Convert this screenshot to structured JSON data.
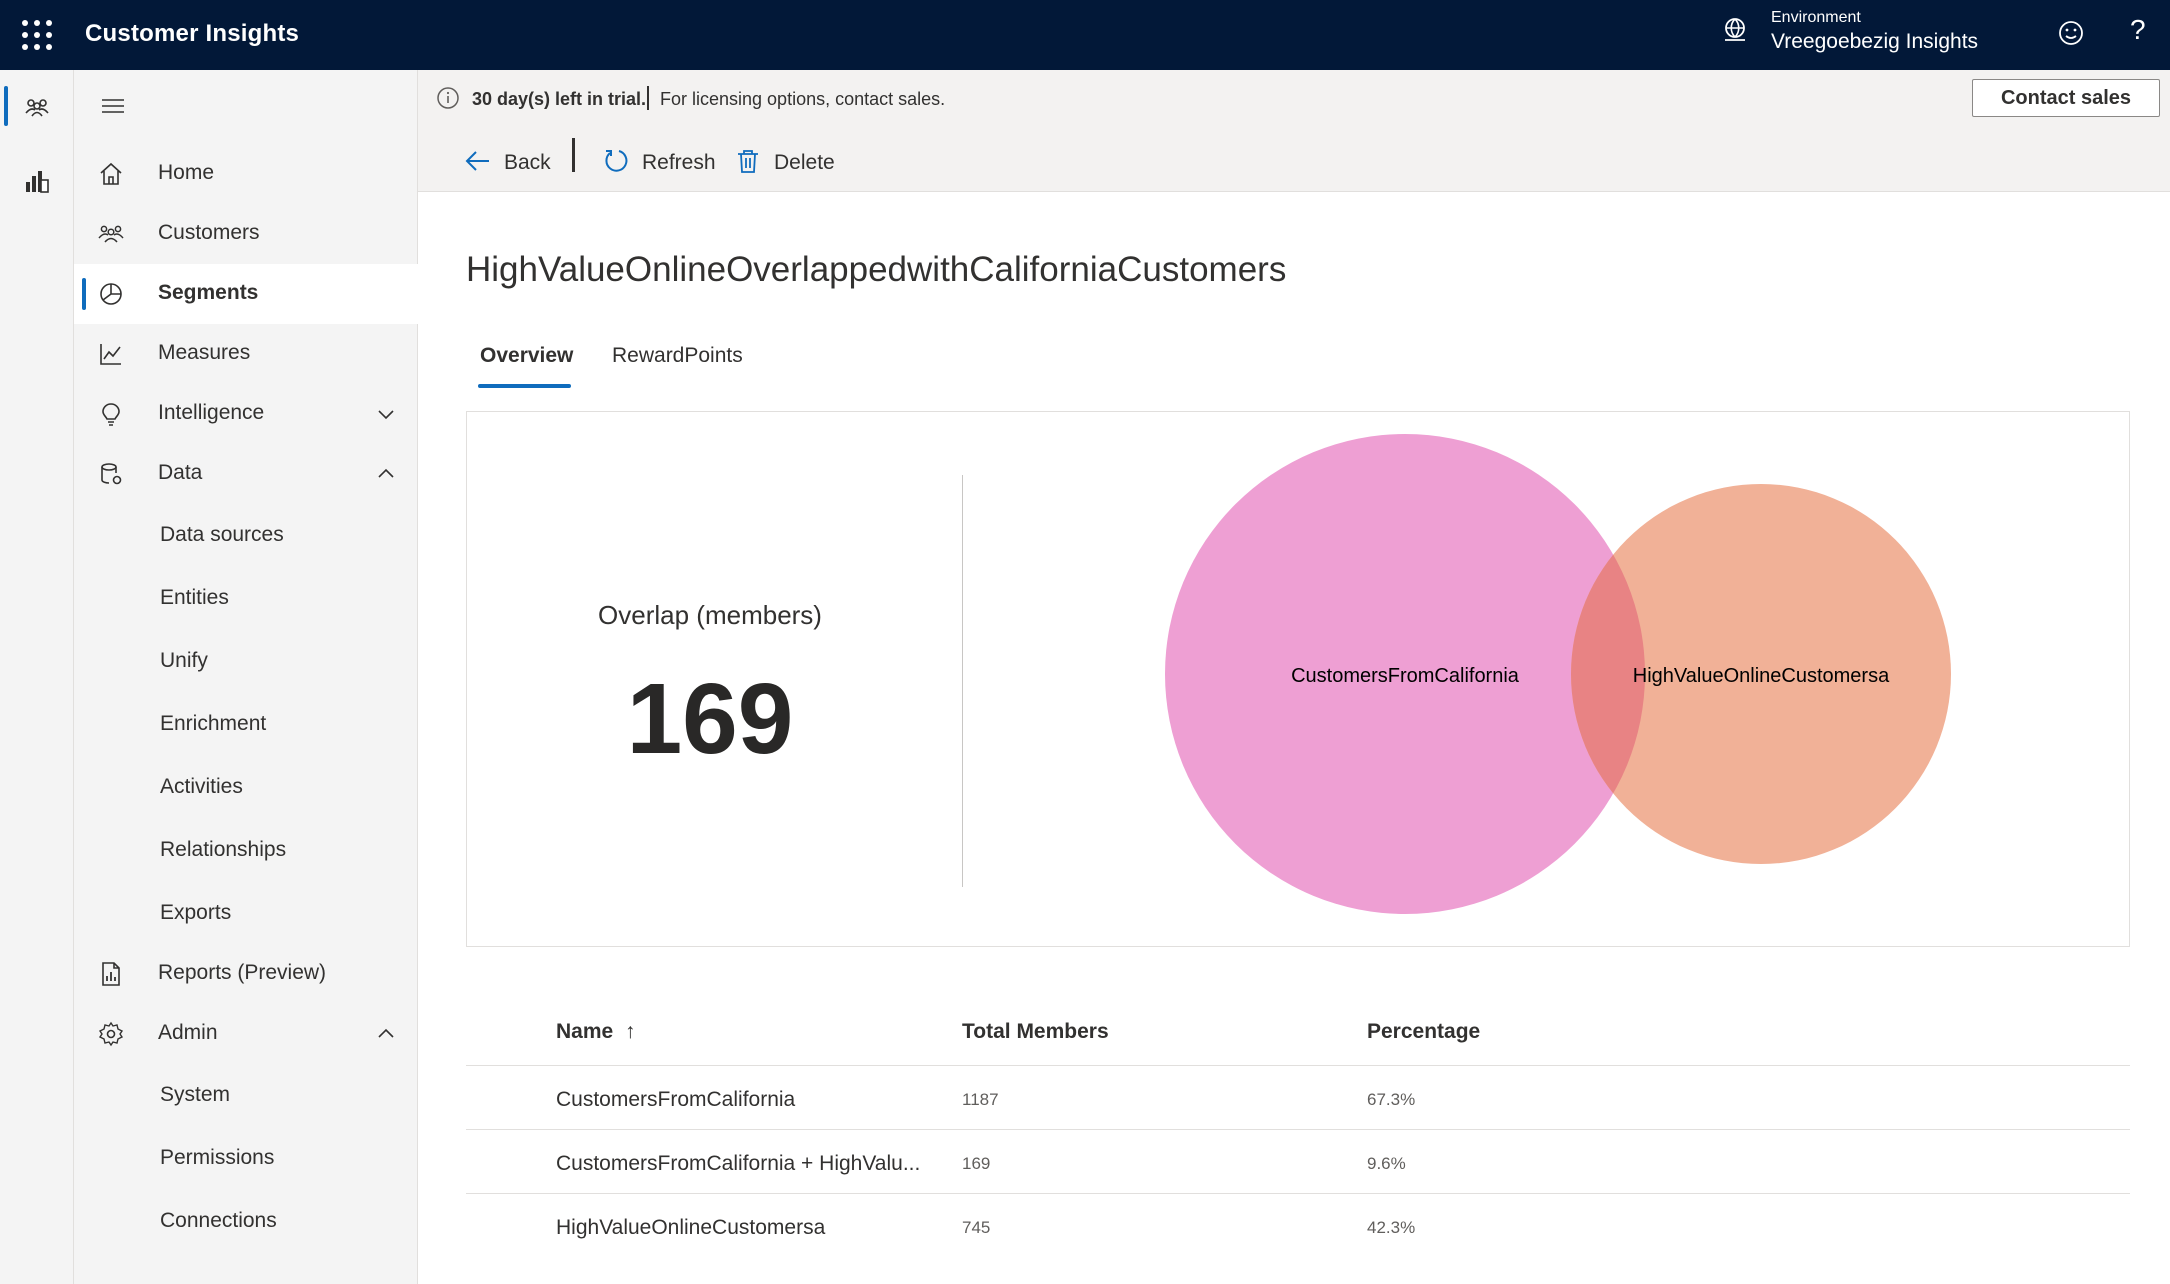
{
  "topbar": {
    "app_title": "Customer Insights",
    "env_label": "Environment",
    "env_name": "Vreegoebezig Insights",
    "help_glyph": "?"
  },
  "rail": {
    "items": [
      {
        "icon": "people-icon",
        "active": true
      },
      {
        "icon": "analytics-icon",
        "active": false
      }
    ]
  },
  "sidebar": {
    "items": [
      {
        "label": "Home",
        "icon": "home-icon"
      },
      {
        "label": "Customers",
        "icon": "customers-icon"
      },
      {
        "label": "Segments",
        "icon": "segments-icon",
        "selected": true
      },
      {
        "label": "Measures",
        "icon": "measures-icon"
      },
      {
        "label": "Intelligence",
        "icon": "lightbulb-icon",
        "chevron": "down"
      },
      {
        "label": "Data",
        "icon": "database-icon",
        "chevron": "up"
      }
    ],
    "data_sub": [
      "Data sources",
      "Entities",
      "Unify",
      "Enrichment",
      "Activities",
      "Relationships",
      "Exports"
    ],
    "reports": {
      "label": "Reports (Preview)",
      "icon": "report-icon"
    },
    "admin": {
      "label": "Admin",
      "icon": "gear-icon",
      "chevron": "up"
    },
    "admin_sub": [
      "System",
      "Permissions",
      "Connections"
    ]
  },
  "trial": {
    "bold": "30 day(s) left in trial.",
    "rest": "For licensing options, contact sales.",
    "contact_button": "Contact sales"
  },
  "commands": {
    "back": "Back",
    "refresh": "Refresh",
    "delete": "Delete"
  },
  "page": {
    "title": "HighValueOnlineOverlappedwithCaliforniaCustomers",
    "tabs": [
      "Overview",
      "RewardPoints"
    ]
  },
  "overlap": {
    "label": "Overlap (members)",
    "value": "169"
  },
  "venn": {
    "left_label": "CustomersFromCalifornia",
    "right_label": "HighValueOnlineCustomersa",
    "left_color": "#ee9fd3",
    "right_color": "#f1b197",
    "overlap_color": "#e88384"
  },
  "table": {
    "headers": {
      "name": "Name",
      "sort_glyph": "↑",
      "total": "Total Members",
      "percentage": "Percentage"
    },
    "rows": [
      {
        "name": "CustomersFromCalifornia",
        "total": "1187",
        "percentage": "67.3%"
      },
      {
        "name": "CustomersFromCalifornia + HighValu...",
        "total": "169",
        "percentage": "9.6%"
      },
      {
        "name": "HighValueOnlineCustomersa",
        "total": "745",
        "percentage": "42.3%"
      }
    ]
  }
}
